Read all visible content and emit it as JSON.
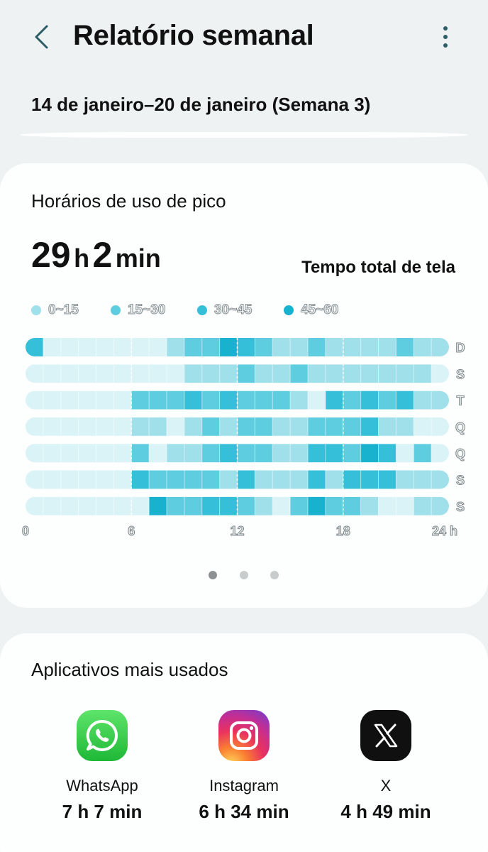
{
  "header": {
    "title": "Relatório semanal",
    "back_icon": "chevron-left-icon",
    "more_icon": "more-vertical-icon"
  },
  "period": {
    "label": "14 de janeiro–20 de janeiro (Semana 3)"
  },
  "peak": {
    "title": "Horários de uso de pico",
    "total": {
      "hours": "29",
      "hours_unit": "h",
      "minutes": "2",
      "minutes_unit": "min"
    },
    "total_label": "Tempo total de tela",
    "legend": [
      {
        "label": "0~15",
        "color": "#9fe0eb"
      },
      {
        "label": "15~30",
        "color": "#5fcde0"
      },
      {
        "label": "30~45",
        "color": "#35bfd8"
      },
      {
        "label": "45~60",
        "color": "#18b2cf"
      }
    ],
    "level_colors": [
      "#d9f3f7",
      "#9fe0eb",
      "#5fcde0",
      "#35bfd8",
      "#18b2cf"
    ],
    "days": [
      "D",
      "S",
      "T",
      "Q",
      "Q",
      "S",
      "S"
    ],
    "hour_labels": [
      "0",
      "6",
      "12",
      "18",
      "24 h"
    ],
    "hour_ticks": [
      0,
      6,
      12,
      18,
      24
    ],
    "grid": [
      [
        3,
        0,
        0,
        0,
        0,
        0,
        0,
        0,
        1,
        2,
        2,
        4,
        3,
        2,
        1,
        1,
        2,
        1,
        1,
        1,
        1,
        2,
        1,
        1
      ],
      [
        0,
        0,
        0,
        0,
        0,
        0,
        0,
        0,
        0,
        1,
        1,
        1,
        2,
        1,
        1,
        2,
        1,
        1,
        1,
        1,
        1,
        1,
        1,
        0
      ],
      [
        0,
        0,
        0,
        0,
        0,
        0,
        2,
        2,
        2,
        3,
        2,
        3,
        2,
        2,
        2,
        1,
        0,
        3,
        2,
        3,
        2,
        3,
        1,
        1
      ],
      [
        0,
        0,
        0,
        0,
        0,
        0,
        1,
        1,
        0,
        1,
        2,
        1,
        2,
        2,
        1,
        1,
        2,
        2,
        2,
        3,
        1,
        1,
        0,
        0
      ],
      [
        0,
        0,
        0,
        0,
        0,
        0,
        2,
        0,
        1,
        1,
        2,
        3,
        2,
        2,
        1,
        1,
        3,
        3,
        2,
        4,
        3,
        0,
        2,
        0
      ],
      [
        0,
        0,
        0,
        0,
        0,
        0,
        3,
        2,
        2,
        2,
        2,
        1,
        3,
        1,
        1,
        1,
        3,
        1,
        3,
        3,
        3,
        1,
        1,
        1
      ],
      [
        0,
        0,
        0,
        0,
        0,
        0,
        0,
        4,
        2,
        2,
        3,
        3,
        2,
        1,
        0,
        2,
        4,
        2,
        2,
        1,
        0,
        0,
        1,
        1
      ]
    ],
    "pager": {
      "count": 3,
      "active": 0
    }
  },
  "apps": {
    "title": "Aplicativos mais usados",
    "items": [
      {
        "name": "WhatsApp",
        "time": "7 h 7 min",
        "icon": "whatsapp-icon"
      },
      {
        "name": "Instagram",
        "time": "6 h 34 min",
        "icon": "instagram-icon"
      },
      {
        "name": "X",
        "time": "4 h 49 min",
        "icon": "x-icon"
      }
    ]
  }
}
